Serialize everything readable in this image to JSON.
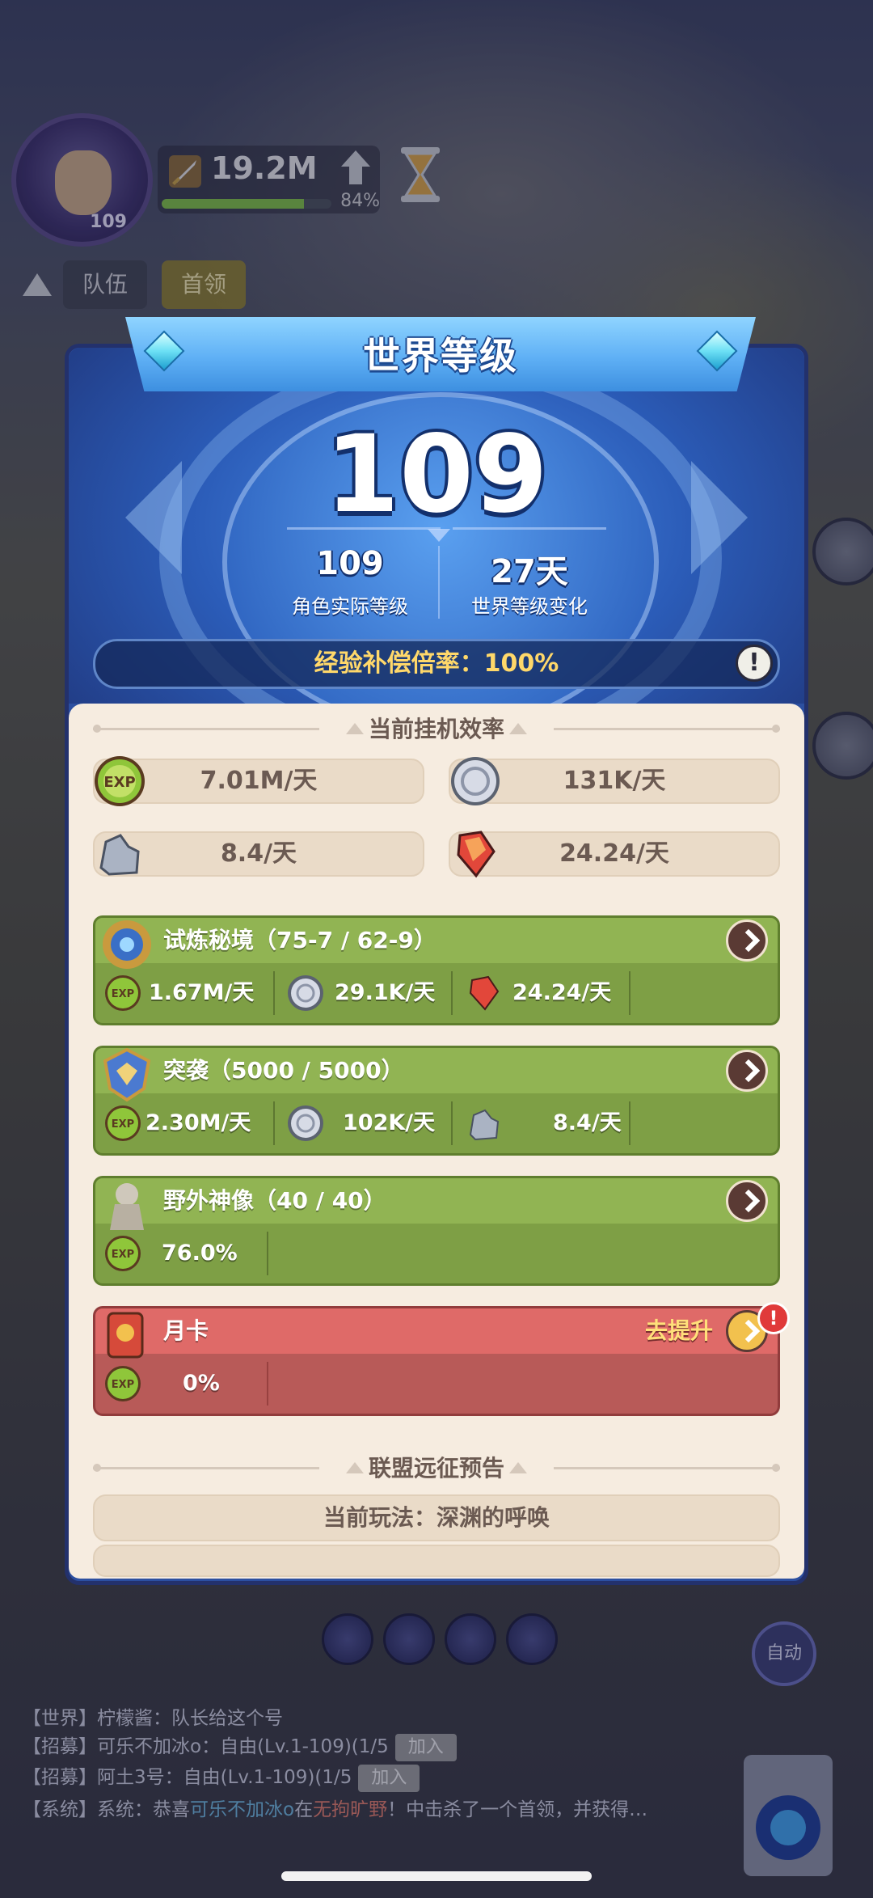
{
  "hud": {
    "avatar_level": "109",
    "power": "19.2M",
    "power_progress_pct": "84%",
    "power_progress": 0.84,
    "tabs": [
      "队伍",
      "首领"
    ]
  },
  "modal": {
    "title": "世界等级",
    "world_level": "109",
    "actual_level": "109",
    "actual_level_label": "角色实际等级",
    "change_days": "27天",
    "change_days_label": "世界等级变化",
    "exp_rate_label": "经验补偿倍率：",
    "exp_rate_value": "100%",
    "info_icon": "!"
  },
  "efficiency": {
    "header": "当前挂机效率",
    "exp": "7.01M/天",
    "coin": "131K/天",
    "stone": "8.4/天",
    "crystal": "24.24/天"
  },
  "sources": [
    {
      "title": "试炼秘境（75-7 / 62-9）",
      "values": [
        "1.67M/天",
        "29.1K/天",
        "24.24/天"
      ]
    },
    {
      "title": "突袭（5000 / 5000）",
      "values": [
        "2.30M/天",
        "102K/天",
        "8.4/天"
      ]
    },
    {
      "title": "野外神像（40 / 40）",
      "values": [
        "76.0%"
      ]
    },
    {
      "title": "月卡",
      "upgrade": "去提升",
      "badge": "!",
      "values": [
        "0%"
      ]
    }
  ],
  "alliance": {
    "header": "联盟远征预告",
    "current": "当前玩法：深渊的呼唤"
  },
  "chat": {
    "lines": [
      {
        "channel": "【世界】",
        "text": "柠檬酱：队长给这个号"
      },
      {
        "channel": "【招募】",
        "text": "可乐不加冰o：自由(Lv.1-109)(1/5",
        "button": "加入"
      },
      {
        "channel": "【招募】",
        "text": "阿土3号：自由(Lv.1-109)(1/5",
        "button": "加入"
      },
      {
        "channel": "【系统】",
        "prefix": "系统：恭喜",
        "name": "可乐不加冰o",
        "mid": "在",
        "place": "无拘旷野",
        "suffix": "！中击杀了一个首领，并获得…"
      }
    ],
    "auto_label": "自动"
  },
  "colors": {
    "modal_blue": "#2c4fa0",
    "exp_rate_gold": "#ffd86a",
    "card_green": "#91b453",
    "card_red": "#df6a68",
    "panel_cream": "#f6ece0"
  }
}
